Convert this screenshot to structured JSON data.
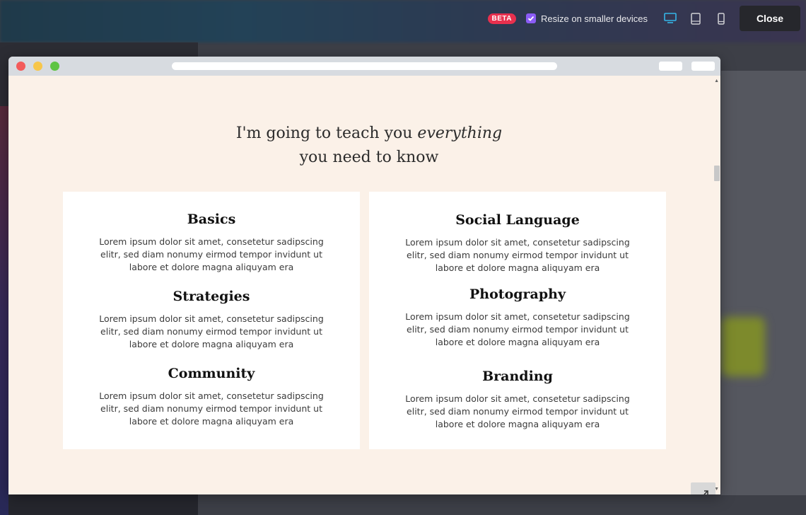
{
  "toolbar": {
    "beta_badge": "BETA",
    "resize_label": "Resize on smaller devices",
    "resize_checked": true,
    "close_label": "Close",
    "devices": [
      "desktop-icon",
      "tablet-icon",
      "phone-icon"
    ],
    "accent_color": "#8b5cf6",
    "beta_color": "#e8304e"
  },
  "page": {
    "headline_line1_prefix": "I'm going to teach you ",
    "headline_line1_em": "everything",
    "headline_line2": "you need to know",
    "background": "#fbf1e8",
    "highlight_color": "#f0c2b0"
  },
  "cards": {
    "left": [
      {
        "title": "Basics",
        "body": "Lorem ipsum dolor sit amet, consetetur sadipscing elitr, sed diam nonumy eirmod tempor invidunt ut labore et dolore magna aliquyam era"
      },
      {
        "title": "Strategies",
        "body": "Lorem ipsum dolor sit amet, consetetur sadipscing elitr, sed diam nonumy eirmod tempor invidunt ut labore et dolore magna aliquyam era"
      },
      {
        "title": "Community",
        "body": "Lorem ipsum dolor sit amet, consetetur sadipscing elitr, sed diam nonumy eirmod tempor invidunt ut labore et dolore magna aliquyam era"
      }
    ],
    "right": [
      {
        "title": "Social Language",
        "body": "Lorem ipsum dolor sit amet, consetetur sadipscing elitr, sed diam nonumy eirmod tempor invidunt ut labore et dolore magna aliquyam era"
      },
      {
        "title": "Photography",
        "body": "Lorem ipsum dolor sit amet, consetetur sadipscing elitr, sed diam nonumy eirmod tempor invidunt ut labore et dolore magna aliquyam era"
      },
      {
        "title": "Branding",
        "body": "Lorem ipsum dolor sit amet, consetetur sadipscing elitr, sed diam nonumy eirmod tempor invidunt ut labore et dolore magna aliquyam era"
      }
    ]
  }
}
